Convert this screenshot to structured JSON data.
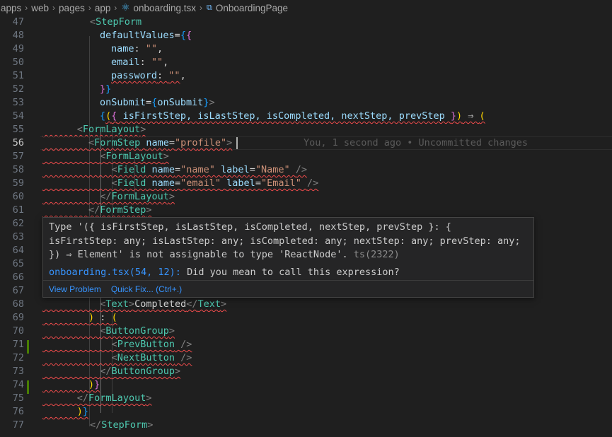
{
  "breadcrumb": {
    "parts": [
      "apps",
      "web",
      "pages",
      "app"
    ],
    "file": "onboarding.tsx",
    "file_icon": "react-icon",
    "symbol": "OnboardingPage",
    "symbol_icon": "symbol-method-icon"
  },
  "editor": {
    "current_line": 56,
    "blame": "You, 1 second ago • Uncommitted changes",
    "line_numbers": [
      "47",
      "48",
      "49",
      "50",
      "51",
      "52",
      "53",
      "54",
      "55",
      "56",
      "57",
      "58",
      "59",
      "60",
      "61",
      "62",
      "63",
      "64",
      "65",
      "66",
      "67",
      "68",
      "69",
      "70",
      "71",
      "72",
      "73",
      "74",
      "75",
      "76",
      "77"
    ],
    "code": {
      "l47_tag": "StepForm",
      "l48_attr": "defaultValues",
      "l49_key": "name",
      "l49_val": "\"\"",
      "l50_key": "email",
      "l50_val": "\"\"",
      "l51_key": "password",
      "l51_val": "\"\"",
      "l53_attr": "onSubmit",
      "l53_val": "onSubmit",
      "l54_args": "isFirstStep, isLastStep, isCompleted, nextStep, prevStep",
      "l55_tag": "FormLayout",
      "l56_tag": "FormStep",
      "l56_attr": "name",
      "l56_val_a": "\"pro",
      "l56_val_b": "file\"",
      "l57_tag": "FormLayout",
      "l58_tag": "Field",
      "l58_name": "\"name\"",
      "l58_label": "\"Name\"",
      "l59_tag": "Field",
      "l59_name": "\"email\"",
      "l59_label": "\"Email\"",
      "l60_tag": "FormLayout",
      "l61_tag": "FormStep",
      "l68_tag": "Text",
      "l68_text": "Completed",
      "l70_tag": "ButtonGroup",
      "l71_tag": "PrevButton",
      "l72_tag": "NextButton",
      "l73_tag": "ButtonGroup",
      "l75_tag": "FormLayout",
      "l77_tag": "StepForm",
      "attr_name": "name",
      "attr_label": "label"
    }
  },
  "hover": {
    "line1": "Type '({ isFirstStep, isLastStep, isCompleted, nextStep, prevStep }: {",
    "line2": "isFirstStep: any; isLastStep: any; isCompleted: any; nextStep: any; prevStep: any;",
    "line3": "}) ⇒ Element' is not assignable to type 'ReactNode'.",
    "source": "ts(2322)",
    "related_link": "onboarding.tsx(54, 12):",
    "related_msg": "Did you mean to call this expression?",
    "view_problem": "View Problem",
    "quick_fix": "Quick Fix... (Ctrl+.)"
  },
  "colors": {
    "background": "#1f1f1f",
    "tag": "#4ec9b0",
    "attribute": "#9cdcfe",
    "string": "#ce9178",
    "error_squiggle": "#f14c4c",
    "link": "#3794ff",
    "git_added": "#487e02"
  }
}
